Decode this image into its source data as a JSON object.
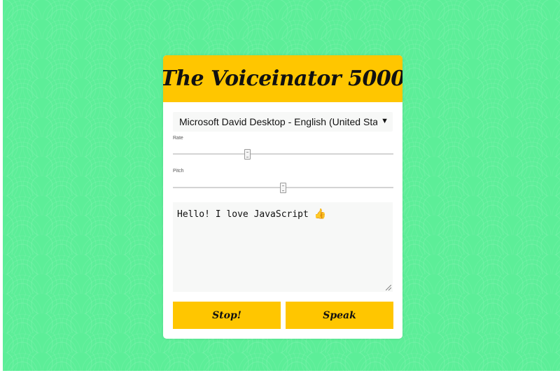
{
  "app": {
    "title": "The Voiceinator 5000"
  },
  "voice_select": {
    "selected": "Microsoft David Desktop - English (United States)"
  },
  "controls": {
    "rate": {
      "label": "Rate",
      "value": 1,
      "min": 0,
      "max": 3
    },
    "pitch": {
      "label": "Pitch",
      "value": 1,
      "min": 0,
      "max": 2
    }
  },
  "message": {
    "text": "Hello! I love JavaScript"
  },
  "buttons": {
    "stop_label": "Stop!",
    "speak_label": "Speak"
  },
  "colors": {
    "background": "#5cee98",
    "accent": "#ffc600",
    "panel": "#ffffff"
  }
}
